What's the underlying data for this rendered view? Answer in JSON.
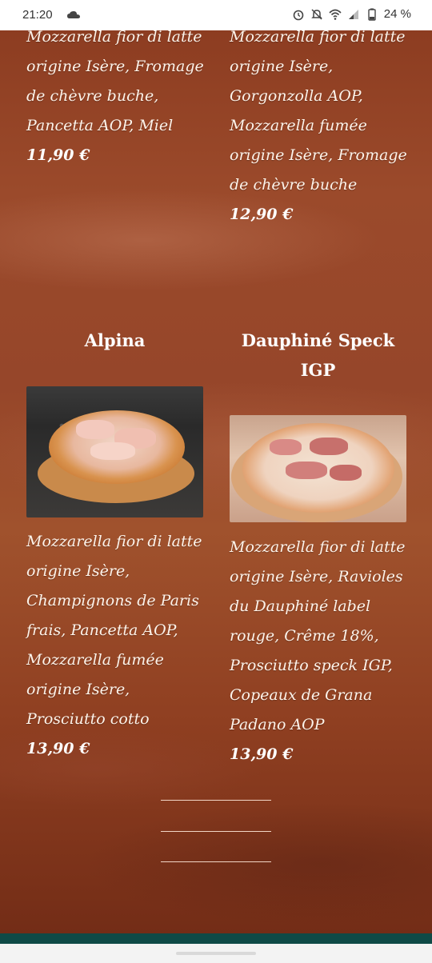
{
  "status_bar": {
    "time": "21:20",
    "battery": "24 %",
    "icons": [
      "cloud-icon",
      "alarm-icon",
      "mute-icon",
      "wifi-icon",
      "signal-icon",
      "battery-icon"
    ]
  },
  "items": [
    {
      "id": "left-top",
      "description_lines": [
        "Mozzarella fior di latte",
        "origine Isère, Fromage",
        "de chèvre buche,",
        "Pancetta AOP, Miel"
      ],
      "price": "11,90 €"
    },
    {
      "id": "right-top",
      "description_lines": [
        "Mozzarella fior di latte",
        "origine Isère,",
        "Gorgonzolla AOP,",
        "Mozzarella fumée",
        "origine Isère, Fromage",
        "de chèvre buche"
      ],
      "price": "12,90 €"
    },
    {
      "id": "alpina",
      "name": "Alpina",
      "description_lines": [
        "Mozzarella fior di latte",
        "origine Isère,",
        "Champignons de Paris",
        "frais, Pancetta AOP,",
        "Mozzarella fumée",
        "origine Isère,",
        "Prosciutto cotto"
      ],
      "price": "13,90 €"
    },
    {
      "id": "dauphine",
      "name_lines": [
        "Dauphiné Speck",
        "IGP"
      ],
      "description_lines": [
        "Mozzarella fior di latte",
        "origine Isère, Ravioles",
        "du Dauphiné label",
        "rouge, Crême 18%,",
        "Prosciutto speck IGP,",
        "Copeaux de Grana",
        "Padano AOP"
      ],
      "price": "13,90 €"
    }
  ],
  "colors": {
    "background": "#8a3a1e",
    "text": "#ffffff",
    "nav_bar": "#0f4a46"
  }
}
